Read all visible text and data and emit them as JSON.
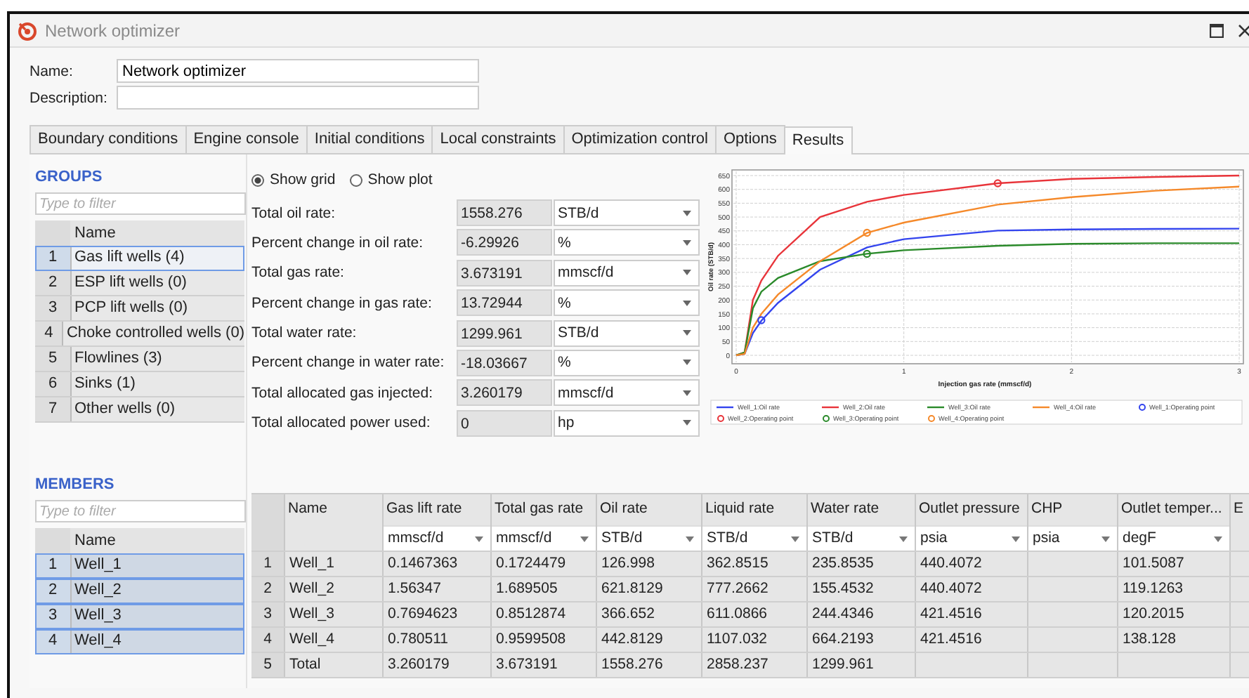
{
  "window": {
    "title": "Network optimizer"
  },
  "name_field": {
    "label": "Name:",
    "value": "Network optimizer"
  },
  "description_field": {
    "label": "Description:"
  },
  "tabs": [
    {
      "label": "Boundary conditions",
      "selected": false
    },
    {
      "label": "Engine console",
      "selected": false
    },
    {
      "label": "Initial conditions",
      "selected": false
    },
    {
      "label": "Local constraints",
      "selected": false
    },
    {
      "label": "Optimization control",
      "selected": false
    },
    {
      "label": "Options",
      "selected": false
    },
    {
      "label": "Results",
      "selected": true
    }
  ],
  "groups": {
    "title": "GROUPS",
    "filter": {
      "placeholder": "Type to filter"
    },
    "column": "Name",
    "rows": [
      {
        "index": "1",
        "name": "Gas lift wells (4)",
        "selected": true
      },
      {
        "index": "2",
        "name": "ESP lift wells (0)",
        "selected": false
      },
      {
        "index": "3",
        "name": "PCP lift wells (0)",
        "selected": false
      },
      {
        "index": "4",
        "name": "Choke controlled wells (0)",
        "selected": false
      },
      {
        "index": "5",
        "name": "Flowlines (3)",
        "selected": false
      },
      {
        "index": "6",
        "name": "Sinks (1)",
        "selected": false
      },
      {
        "index": "7",
        "name": "Other wells (0)",
        "selected": false
      }
    ]
  },
  "members": {
    "title": "MEMBERS",
    "filter": {
      "placeholder": "Type to filter"
    },
    "column": "Name",
    "rows": [
      {
        "index": "1",
        "name": "Well_1",
        "selected": true
      },
      {
        "index": "2",
        "name": "Well_2",
        "selected": true
      },
      {
        "index": "3",
        "name": "Well_3",
        "selected": true
      },
      {
        "index": "4",
        "name": "Well_4",
        "selected": true
      }
    ]
  },
  "view_mode": [
    {
      "label": "Show grid",
      "selected": true
    },
    {
      "label": "Show plot",
      "selected": false
    }
  ],
  "summary": [
    {
      "label": "Total oil rate:",
      "value": "1558.276",
      "unit": "STB/d"
    },
    {
      "label": "Percent change in oil rate:",
      "value": "-6.29926",
      "unit": "%"
    },
    {
      "label": "Total gas rate:",
      "value": "3.673191",
      "unit": "mmscf/d"
    },
    {
      "label": "Percent change in gas rate:",
      "value": "13.72944",
      "unit": "%"
    },
    {
      "label": "Total water rate:",
      "value": "1299.961",
      "unit": "STB/d"
    },
    {
      "label": "Percent change in water rate:",
      "value": "-18.03667",
      "unit": "%"
    },
    {
      "label": "Total allocated gas injected:",
      "value": "3.260179",
      "unit": "mmscf/d"
    },
    {
      "label": "Total allocated power used:",
      "value": "0",
      "unit": "hp"
    }
  ],
  "chart": {
    "chart_data": {
      "type": "line",
      "xlabel": "Injection gas rate (mmscf/d)",
      "ylabel": "Oil rate (STB/d)",
      "x": [
        0,
        0.05,
        0.1,
        0.15,
        0.25,
        0.5,
        0.78,
        1,
        1.56,
        2,
        2.5,
        3
      ],
      "series": [
        {
          "name": "Well_1:Oil rate",
          "type": "line",
          "color": "#3344ee",
          "values": [
            0,
            5,
            80,
            125,
            190,
            310,
            390,
            420,
            451,
            455,
            457,
            458
          ]
        },
        {
          "name": "Well_2:Oil rate",
          "type": "line",
          "color": "#e8343a",
          "values": [
            0,
            10,
            200,
            270,
            360,
            500,
            555,
            580,
            622,
            638,
            645,
            650
          ]
        },
        {
          "name": "Well_3:Oil rate",
          "type": "line",
          "color": "#2a8a2a",
          "values": [
            0,
            10,
            170,
            230,
            280,
            340,
            367,
            380,
            396,
            403,
            405,
            405
          ]
        },
        {
          "name": "Well_4:Oil rate",
          "type": "line",
          "color": "#f5892a",
          "values": [
            0,
            5,
            100,
            150,
            220,
            340,
            443,
            480,
            545,
            572,
            595,
            610
          ]
        },
        {
          "name": "Well_1:Operating point",
          "type": "scatter",
          "color": "#3344ee",
          "values": [
            null,
            null,
            null,
            127,
            null,
            null,
            null,
            null,
            null,
            null,
            null,
            null
          ]
        },
        {
          "name": "Well_2:Operating point",
          "type": "scatter",
          "color": "#e8343a",
          "values": [
            null,
            null,
            null,
            null,
            null,
            null,
            null,
            null,
            622,
            null,
            null,
            null
          ]
        },
        {
          "name": "Well_3:Operating point",
          "type": "scatter",
          "color": "#2a8a2a",
          "values": [
            null,
            null,
            null,
            null,
            null,
            null,
            367,
            null,
            null,
            null,
            null,
            null
          ]
        },
        {
          "name": "Well_4:Operating point",
          "type": "scatter",
          "color": "#f5892a",
          "values": [
            null,
            null,
            null,
            null,
            null,
            null,
            443,
            null,
            null,
            null,
            null,
            null
          ]
        }
      ],
      "grid": true,
      "legend": "bottom",
      "xlim": [
        0,
        3
      ],
      "ylim": [
        0,
        650
      ],
      "xticks": [
        0,
        1,
        2,
        3
      ],
      "yticks": [
        0,
        50,
        100,
        150,
        200,
        250,
        300,
        350,
        400,
        450,
        500,
        550,
        600,
        650
      ]
    }
  },
  "results_table": {
    "columns": [
      {
        "name": "Name"
      },
      {
        "name": "Gas lift rate",
        "unit": "mmscf/d"
      },
      {
        "name": "Total gas rate",
        "unit": "mmscf/d"
      },
      {
        "name": "Oil rate",
        "unit": "STB/d"
      },
      {
        "name": "Liquid rate",
        "unit": "STB/d"
      },
      {
        "name": "Water rate",
        "unit": "STB/d"
      },
      {
        "name": "Outlet pressure",
        "unit": "psia"
      },
      {
        "name": "CHP",
        "unit": "psia"
      },
      {
        "name": "Outlet temper...",
        "unit": "degF"
      },
      {
        "name": "E"
      }
    ],
    "rows": [
      {
        "index": "1",
        "cells": [
          "Well_1",
          "0.1467363",
          "0.1724479",
          "126.998",
          "362.8515",
          "235.8535",
          "440.4072",
          null,
          "101.5087"
        ]
      },
      {
        "index": "2",
        "cells": [
          "Well_2",
          "1.56347",
          "1.689505",
          "621.8129",
          "777.2662",
          "155.4532",
          "440.4072",
          null,
          "119.1263"
        ]
      },
      {
        "index": "3",
        "cells": [
          "Well_3",
          "0.7694623",
          "0.8512874",
          "366.652",
          "611.0866",
          "244.4346",
          "421.4516",
          null,
          "120.2015"
        ]
      },
      {
        "index": "4",
        "cells": [
          "Well_4",
          "0.780511",
          "0.9599508",
          "442.8129",
          "1107.032",
          "664.2193",
          "421.4516",
          null,
          "138.128"
        ]
      },
      {
        "index": "5",
        "cells": [
          "Total",
          "3.260179",
          "3.673191",
          "1558.276",
          "2858.237",
          "1299.961",
          null,
          null,
          null
        ]
      }
    ]
  }
}
